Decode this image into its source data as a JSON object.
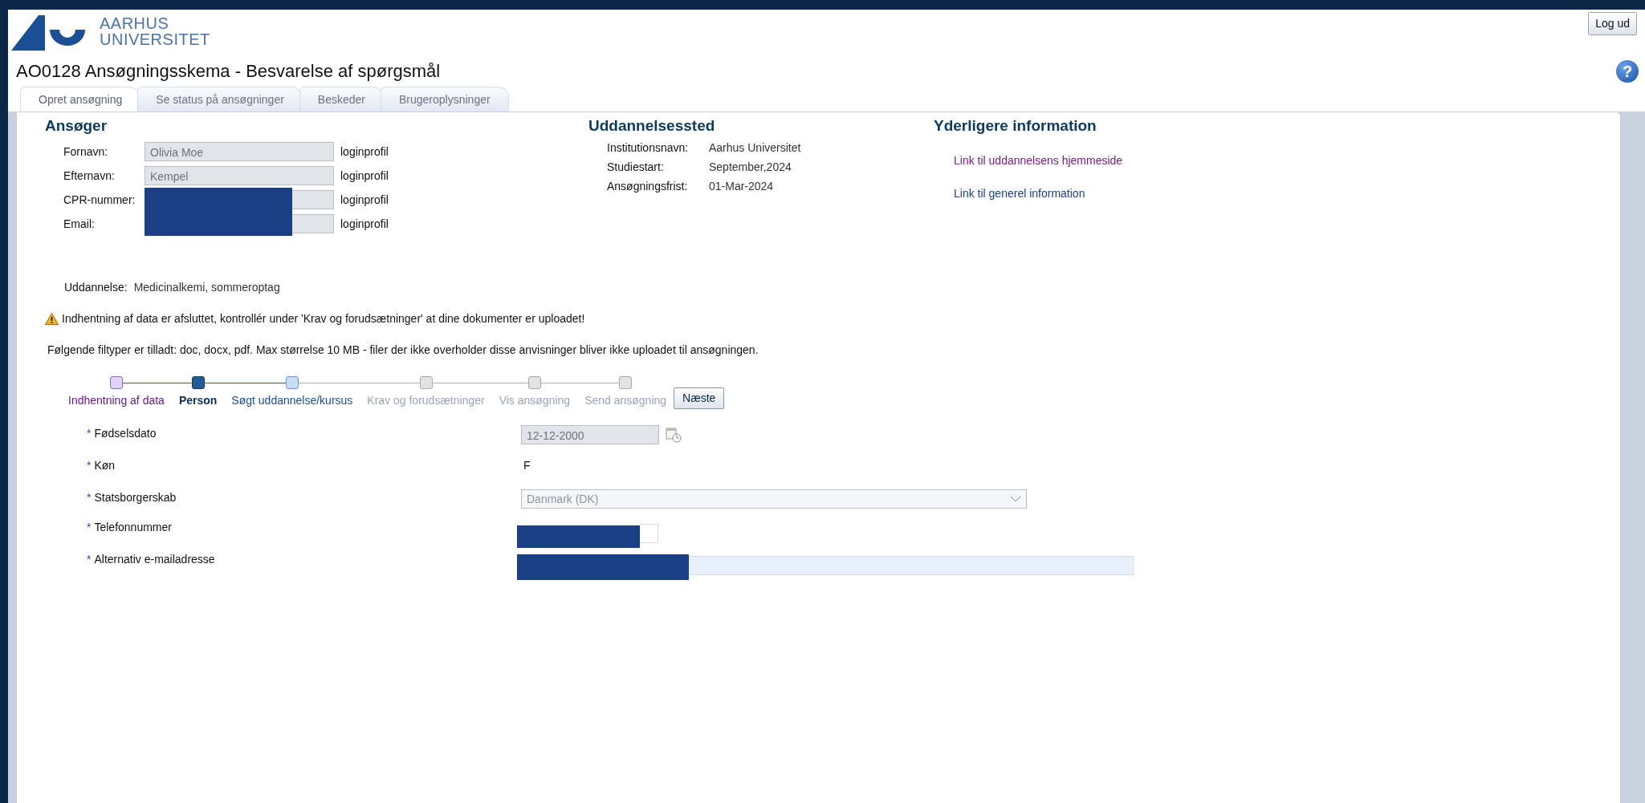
{
  "header": {
    "logo_lines": [
      "AARHUS",
      "UNIVERSITET"
    ],
    "logout_button": "Log ud",
    "help_button": "?"
  },
  "page_title": "AO0128 Ansøgningsskema - Besvarelse af spørgsmål",
  "tabs": [
    {
      "label": "Opret ansøgning",
      "selected": true
    },
    {
      "label": "Se status på ansøgninger",
      "selected": false
    },
    {
      "label": "Beskeder",
      "selected": false
    },
    {
      "label": "Brugeroplysninger",
      "selected": false
    }
  ],
  "applicant": {
    "heading": "Ansøger",
    "fields": [
      {
        "label": "Fornavn:",
        "value": "Olivia Moe",
        "source": "loginprofil"
      },
      {
        "label": "Efternavn:",
        "value": "Kempel",
        "source": "loginprofil"
      },
      {
        "label": "CPR-nummer:",
        "source": "loginprofil",
        "redacted": true
      },
      {
        "label": "Email:",
        "source": "loginprofil",
        "redacted": true
      }
    ]
  },
  "institution": {
    "heading": "Uddannelsessted",
    "rows": [
      {
        "label": "Institutionsnavn:",
        "value": "Aarhus Universitet"
      },
      {
        "label": "Studiestart:",
        "value": "September,2024"
      },
      {
        "label": "Ansøgningsfrist:",
        "value": "01-Mar-2024"
      }
    ]
  },
  "more_info": {
    "heading": "Yderligere information",
    "links": [
      {
        "label": "Link til uddannelsens hjemmeside",
        "visited": true
      },
      {
        "label": "Link til generel information",
        "visited": false
      }
    ]
  },
  "programme": {
    "label": "Uddannelse:",
    "value": "Medicinalkemi, sommeroptag"
  },
  "warning": "Indhentning af data er afsluttet, kontrollér under 'Krav og forudsætninger' at dine dokumenter er uploadet!",
  "file_note": "Følgende filtyper er tilladt: doc, docx, pdf. Max størrelse 10 MB - filer der ikke overholder disse anvisninger bliver ikke uploadet til ansøgningen.",
  "steps": [
    {
      "label": "Indhentning af data",
      "kind": "done"
    },
    {
      "label": "Person",
      "kind": "current"
    },
    {
      "label": "Søgt uddannelse/kursus",
      "kind": "available"
    },
    {
      "label": "Krav og forudsætninger",
      "kind": "locked"
    },
    {
      "label": "Vis ansøgning",
      "kind": "locked"
    },
    {
      "label": "Send ansøgning",
      "kind": "locked"
    }
  ],
  "next_button": "Næste",
  "form": [
    {
      "kind": "date",
      "mark": "*",
      "label": "Fødselsdato",
      "value": "12-12-2000"
    },
    {
      "kind": "static",
      "mark": "*",
      "label": "Køn",
      "value": "F"
    },
    {
      "kind": "select",
      "mark": "*",
      "label": "Statsborgerskab",
      "value": "Danmark (DK)"
    },
    {
      "kind": "phone",
      "mark": "*",
      "label": "Telefonnummer",
      "redacted": true
    },
    {
      "kind": "email",
      "mark": "*",
      "label": "Alternativ e-mailadresse",
      "redacted": true
    }
  ]
}
